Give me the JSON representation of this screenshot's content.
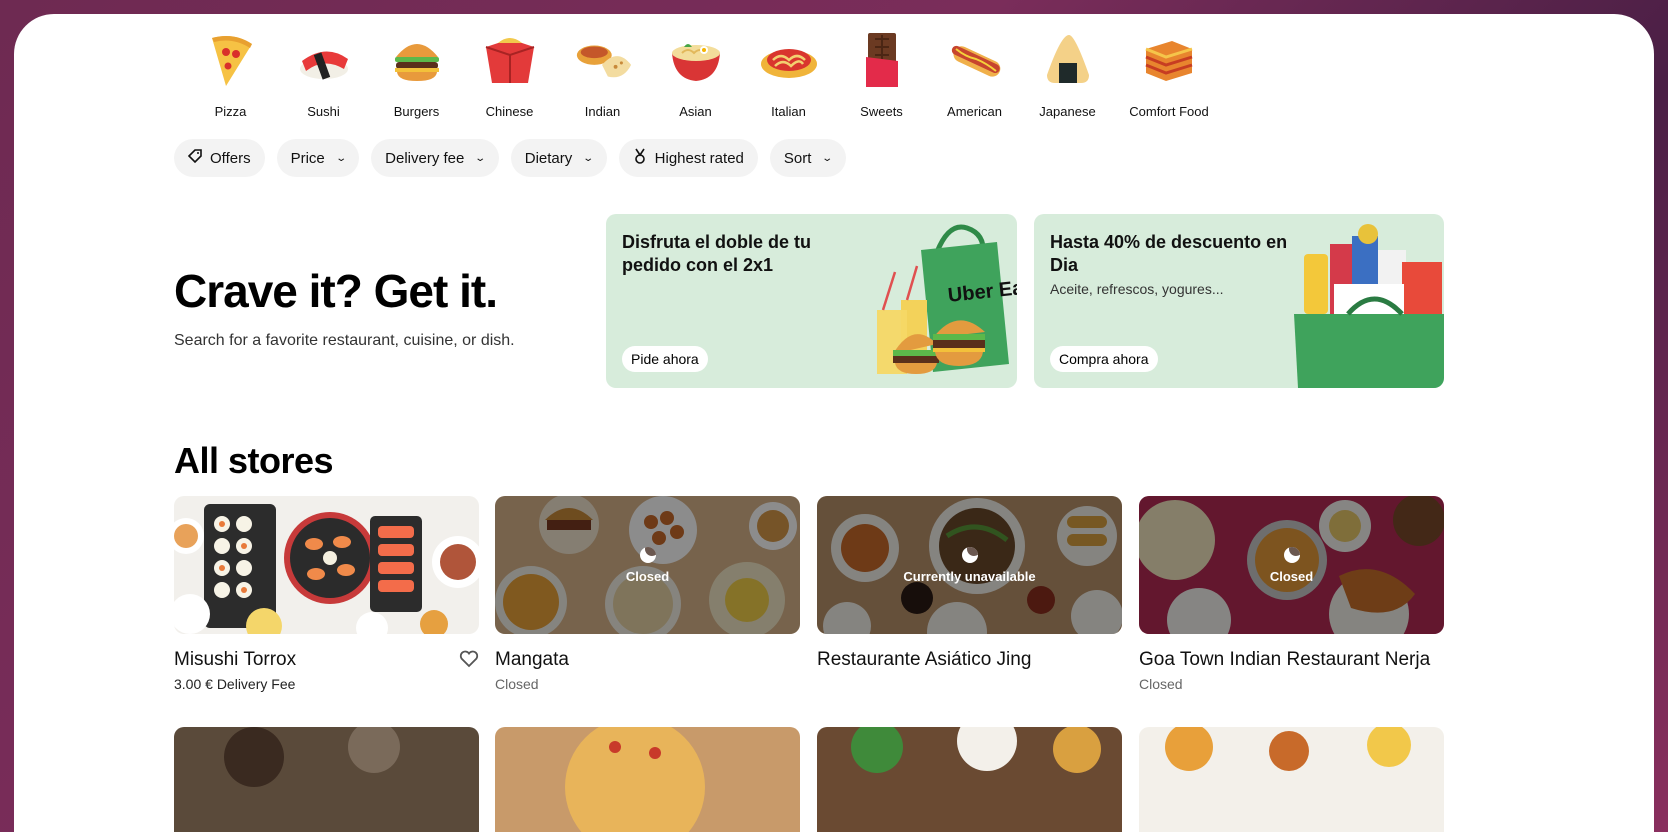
{
  "categories": [
    {
      "label": "Pizza",
      "icon": "pizza-icon"
    },
    {
      "label": "Sushi",
      "icon": "sushi-icon"
    },
    {
      "label": "Burgers",
      "icon": "burger-icon"
    },
    {
      "label": "Chinese",
      "icon": "takeout-box-icon"
    },
    {
      "label": "Indian",
      "icon": "curry-icon"
    },
    {
      "label": "Asian",
      "icon": "noodle-bowl-icon"
    },
    {
      "label": "Italian",
      "icon": "spaghetti-icon"
    },
    {
      "label": "Sweets",
      "icon": "chocolate-icon"
    },
    {
      "label": "American",
      "icon": "hotdog-icon"
    },
    {
      "label": "Japanese",
      "icon": "onigiri-icon"
    },
    {
      "label": "Comfort Food",
      "icon": "lasagna-icon"
    }
  ],
  "filters": [
    {
      "label": "Offers",
      "icon": "tag-icon"
    },
    {
      "label": "Price",
      "chevron": true
    },
    {
      "label": "Delivery fee",
      "chevron": true
    },
    {
      "label": "Dietary",
      "chevron": true
    },
    {
      "label": "Highest rated",
      "icon": "medal-icon"
    },
    {
      "label": "Sort",
      "chevron": true
    }
  ],
  "hero": {
    "title": "Crave it? Get it.",
    "subtitle": "Search for a favorite restaurant, cuisine, or dish."
  },
  "promos": [
    {
      "title": "Disfruta el doble de tu pedido con el 2x1",
      "subtitle": "",
      "button": "Pide ahora",
      "bag_text": "Uber Eats"
    },
    {
      "title": "Hasta 40% de descuento en Dia",
      "subtitle": "Aceite, refrescos, yogures...",
      "button": "Compra ahora"
    }
  ],
  "section_title": "All stores",
  "stores": [
    {
      "name": "Misushi Torrox",
      "meta": "3.00 € Delivery Fee",
      "status": ""
    },
    {
      "name": "Mangata",
      "meta": "Closed",
      "status": "Closed"
    },
    {
      "name": "Restaurante Asiático Jing",
      "meta": "",
      "status": "Currently unavailable"
    },
    {
      "name": "Goa Town Indian Restaurant Nerja",
      "meta": "Closed",
      "status": "Closed"
    }
  ],
  "colors": {
    "promo_bg": "#d7ecdb",
    "chip_bg": "#f3f3f3",
    "uber_green": "#3fa35c"
  }
}
